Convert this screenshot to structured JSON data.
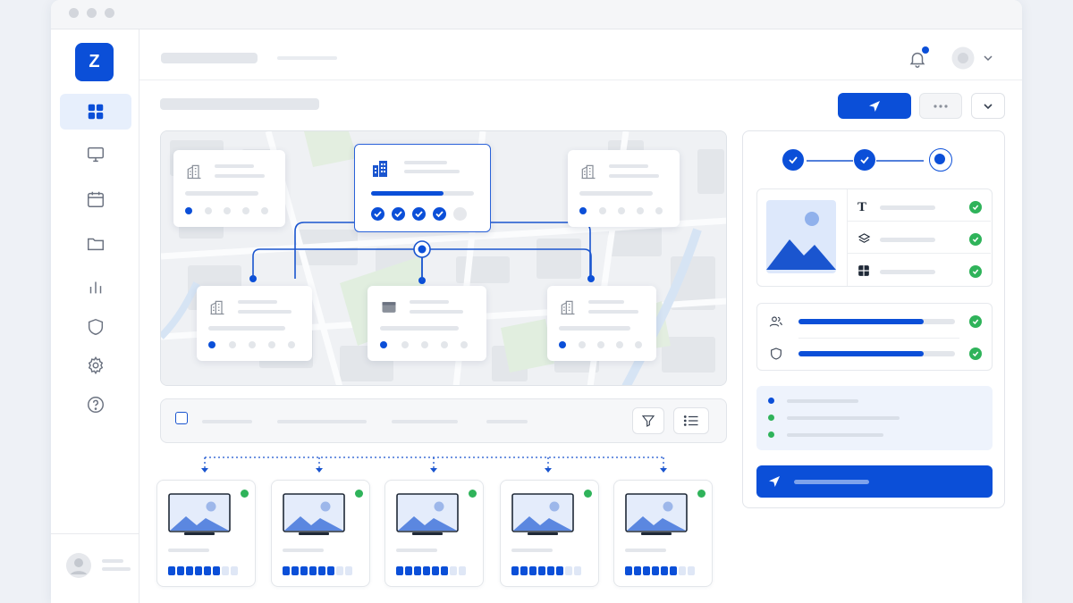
{
  "app": {
    "logo_letter": "Z"
  },
  "colors": {
    "primary": "#0b4fd8",
    "success": "#2fb35a",
    "notification": "#0b4fd8"
  },
  "sidebar": {
    "items": [
      {
        "icon": "grid-icon",
        "active": true
      },
      {
        "icon": "monitor-icon",
        "active": false
      },
      {
        "icon": "calendar-icon",
        "active": false
      },
      {
        "icon": "folder-icon",
        "active": false
      },
      {
        "icon": "bar-chart-icon",
        "active": false
      },
      {
        "icon": "shield-icon",
        "active": false
      },
      {
        "icon": "gear-icon",
        "active": false
      },
      {
        "icon": "help-icon",
        "active": false
      }
    ]
  },
  "header": {
    "icons": [
      "bell-icon",
      "avatar",
      "chevron-down-icon"
    ],
    "has_notification": true
  },
  "actions": {
    "icons": [
      "send-icon",
      "more-icon",
      "chevron-down-icon"
    ]
  },
  "map": {
    "nodes_top": [
      {
        "icon": "building-icon",
        "progress_dots": 5,
        "active_dots": 1
      },
      {
        "icon": "buildings-icon",
        "selected": true,
        "progress": 0.7,
        "checks": 4,
        "total": 5
      },
      {
        "icon": "building-icon",
        "progress_dots": 5,
        "active_dots": 1
      }
    ],
    "nodes_bottom": [
      {
        "icon": "building-icon",
        "progress_dots": 5,
        "active_dots": 1
      },
      {
        "icon": "window-icon",
        "progress_dots": 5,
        "active_dots": 1
      },
      {
        "icon": "building-icon",
        "progress_dots": 5,
        "active_dots": 1
      }
    ]
  },
  "list_toolbar": {
    "icons": [
      "checkbox",
      "filter-icon",
      "list-icon"
    ]
  },
  "devices": [
    {
      "status": "online",
      "level": 6,
      "max": 8
    },
    {
      "status": "online",
      "level": 6,
      "max": 8
    },
    {
      "status": "online",
      "level": 6,
      "max": 8
    },
    {
      "status": "online",
      "level": 6,
      "max": 8
    },
    {
      "status": "online",
      "level": 6,
      "max": 8
    }
  ],
  "right_panel": {
    "steps": [
      "complete",
      "complete",
      "current"
    ],
    "asset_rows": [
      {
        "icon": "text-icon",
        "glyph": "T",
        "status": "ok"
      },
      {
        "icon": "layers-icon",
        "status": "ok"
      },
      {
        "icon": "layout-icon",
        "status": "ok"
      }
    ],
    "bars": [
      {
        "icon": "users-icon",
        "value": 0.8,
        "status": "ok"
      },
      {
        "icon": "shield-icon",
        "value": 0.8,
        "status": "ok"
      }
    ],
    "legend_dot_colors": [
      "#0b4fd8",
      "#2fb35a",
      "#2fb35a"
    ],
    "submit_icon": "send-icon"
  }
}
